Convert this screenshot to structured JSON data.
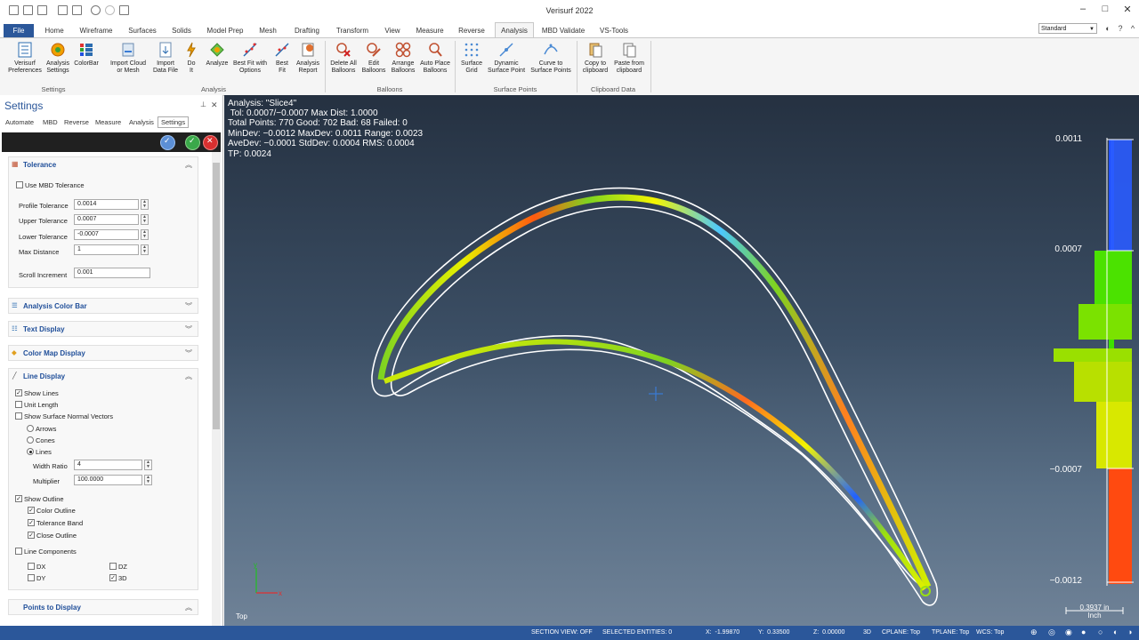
{
  "window": {
    "title": "Verisurf 2022"
  },
  "ribbon_tabs": [
    "File",
    "Home",
    "Wireframe",
    "Surfaces",
    "Solids",
    "Model Prep",
    "Mesh",
    "Drafting",
    "Transform",
    "View",
    "Measure",
    "Reverse",
    "Analysis",
    "MBD Validate",
    "VS-Tools"
  ],
  "active_tab": "Analysis",
  "style_select": "Standard",
  "ribbon": {
    "buttons": [
      {
        "label": "Verisurf\nPreferences"
      },
      {
        "label": "Analysis\nSettings"
      },
      {
        "label": "ColorBar"
      },
      {
        "label": "Import Cloud\nor Mesh"
      },
      {
        "label": "Import\nData File"
      },
      {
        "label": "Do\nIt"
      },
      {
        "label": "Analyze"
      },
      {
        "label": "Best Fit with\nOptions"
      },
      {
        "label": "Best\nFit"
      },
      {
        "label": "Analysis\nReport"
      },
      {
        "label": "Delete All\nBalloons"
      },
      {
        "label": "Edit\nBalloons"
      },
      {
        "label": "Arrange\nBalloons"
      },
      {
        "label": "Auto Place\nBalloons"
      },
      {
        "label": "Surface\nGrid"
      },
      {
        "label": "Dynamic\nSurface Point"
      },
      {
        "label": "Curve to\nSurface Points"
      },
      {
        "label": "Copy to\nclipboard"
      },
      {
        "label": "Paste from\nclipboard"
      }
    ],
    "groups": [
      "Settings",
      "Analysis",
      "Balloons",
      "Surface Points",
      "Clipboard Data"
    ]
  },
  "panel": {
    "title": "Settings",
    "tabs": [
      "Automate",
      "MBD",
      "Reverse",
      "Measure",
      "Analysis",
      "Settings"
    ],
    "active_tab": "Settings",
    "tolerance": {
      "header": "Tolerance",
      "use_mbd": "Use MBD Tolerance",
      "profile_label": "Profile Tolerance",
      "profile_value": "0.0014",
      "upper_label": "Upper Tolerance",
      "upper_value": "0.0007",
      "lower_label": "Lower Tolerance",
      "lower_value": "-0.0007",
      "maxdist_label": "Max Distance",
      "maxdist_value": "1",
      "scroll_label": "Scroll Increment",
      "scroll_value": "0.001"
    },
    "collapsed_sections": [
      "Analysis Color Bar",
      "Text Display",
      "Color Map Display"
    ],
    "line_display": {
      "header": "Line Display",
      "show_lines": "Show Lines",
      "unit_length": "Unit Length",
      "show_normals": "Show Surface Normal Vectors",
      "arrows": "Arrows",
      "cones": "Cones",
      "lines": "Lines",
      "width_label": "Width Ratio",
      "width_value": "4",
      "mult_label": "Multiplier",
      "mult_value": "100.0000",
      "show_outline": "Show Outline",
      "color_outline": "Color Outline",
      "tol_band": "Tolerance Band",
      "close_outline": "Close Outline",
      "line_components": "Line Components",
      "dx": "DX",
      "dy": "DY",
      "dz": "DZ",
      "d3": "3D"
    },
    "points_header": "Points to Display"
  },
  "analysis_text": [
    "Analysis: \"Slice4\"",
    " Tol: 0.0007/−0.0007 Max Dist: 1.0000",
    "Total Points: 770 Good: 702 Bad: 68 Failed: 0",
    "MinDev: −0.0012 MaxDev: 0.0011 Range: 0.0023",
    "AveDev: −0.0001 StdDev: 0.0004 RMS: 0.0004",
    "TP: 0.0024"
  ],
  "colorbar": {
    "labels": [
      "0.0011",
      "0.0007",
      "−0.0007",
      "−0.0012"
    ],
    "colors": {
      "high": "#1f3fff",
      "in_tol": "#3ee000",
      "low": "#ff2a00"
    }
  },
  "viewport": {
    "view_name": "Top",
    "scale": "0.3937 in",
    "scale_unit": "Inch"
  },
  "status": {
    "section_view": "SECTION VIEW: OFF",
    "selected": "SELECTED ENTITIES: 0",
    "x": "X:  -1.99870",
    "y": "Y:  0.33500",
    "z": "Z:  0.00000",
    "mode": "3D",
    "cplane": "CPLANE: Top",
    "tplane": "TPLANE: Top",
    "wcs": "WCS: Top"
  }
}
